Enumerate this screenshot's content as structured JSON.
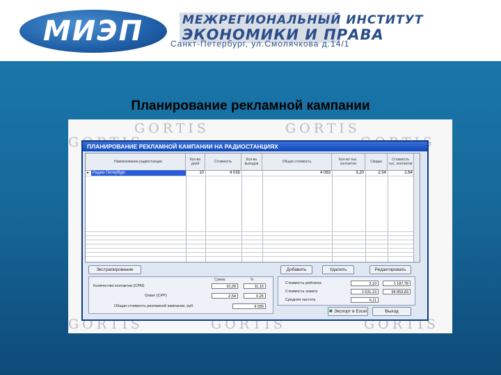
{
  "header": {
    "logo": "МИЭП",
    "institute_line1": "МЕЖРЕГИОНАЛЬНЫЙ ИНСТИТУТ",
    "institute_line2": "ЭКОНОМИКИ И ПРАВА",
    "address": "Санкт-Петербург, ул.Смолячкова д.14/1"
  },
  "slide_title": "Планирование рекламной кампании",
  "watermark": {
    "brand": "GORTIS"
  },
  "window": {
    "title": "ПЛАНИРОВАНИЕ РЕКЛАМНОЙ КАМПАНИИ НА РАДИОСТАНЦИЯХ",
    "columns": [
      "Наименование радиостанции",
      "Кол-во дней",
      "Стоимость",
      "Кол-во выходов",
      "Общая стоимость",
      "Кол-во тыс. контактов",
      "Скидка",
      "Стоимость тыс. контактов"
    ],
    "rows": [
      {
        "station": "Радио Петербург",
        "days": "10",
        "cost": "4 035",
        "outs": "",
        "total": "4 063",
        "contacts": "3,20",
        "discount": "2,54",
        "cpt": "2,64"
      }
    ]
  },
  "buttons": {
    "extra": "Экстрапирование",
    "add": "Добавить",
    "delete": "Удалить",
    "edit": "Редактировать",
    "export": "Экспорт в Excel",
    "exit": "Выход"
  },
  "summary": {
    "col_a": "Сумма",
    "col_b": "%",
    "row1_label": "Количество контактов (CPM)",
    "row1_a": "10,28",
    "row1_b": "11,15",
    "row2_label": "Охват (CPP)",
    "row2_a": "2,54",
    "row2_b": "0,25",
    "total_label": "Общая стоимость рекламной кампании, руб.",
    "total_value": "4 035"
  },
  "stats": {
    "row1_label": "Стоимость рейтинга",
    "row1_a": "3,10",
    "row1_b": "1 187,78",
    "row2_label": "Стоимость охвата",
    "row2_a": "1 531,13",
    "row2_b": "94 853,83",
    "row3_label": "Средняя частота",
    "row3_a": "6,11"
  }
}
